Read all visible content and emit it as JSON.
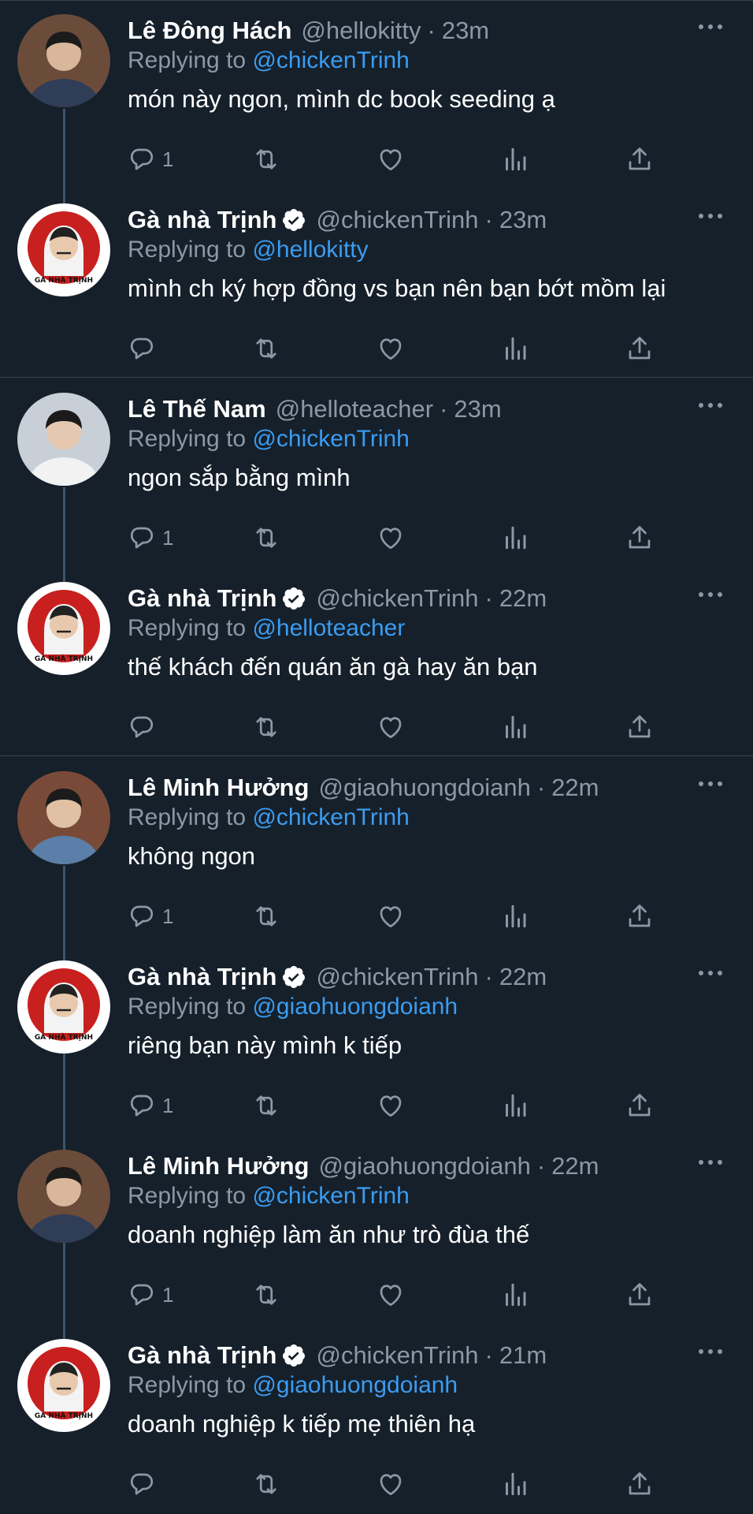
{
  "tweets": [
    {
      "name": "Lê Đông Hách",
      "handle": "@hellokitty",
      "time": "23m",
      "verified": false,
      "reply_label": "Replying to",
      "reply_to": "@chickenTrinh",
      "text": "món này ngon, mình dc book seeding ạ",
      "reply_count": "1",
      "avatar_icon": "person-photo-avatar"
    },
    {
      "name": "Gà nhà Trịnh",
      "handle": "@chickenTrinh",
      "time": "23m",
      "verified": true,
      "reply_label": "Replying to",
      "reply_to": "@hellokitty",
      "text": "mình ch ký hợp đồng vs bạn nên bạn bớt mồm lại",
      "reply_count": "",
      "avatar_icon": "chicken-brand-logo-avatar",
      "avatar_text": "GÀ NHÀ TRỊNH"
    },
    {
      "name": "Lê Thế Nam",
      "handle": "@helloteacher",
      "time": "23m",
      "verified": false,
      "reply_label": "Replying to",
      "reply_to": "@chickenTrinh",
      "text": "ngon sắp bằng mình",
      "reply_count": "1",
      "avatar_icon": "person-photo-avatar"
    },
    {
      "name": "Gà nhà Trịnh",
      "handle": "@chickenTrinh",
      "time": "22m",
      "verified": true,
      "reply_label": "Replying to",
      "reply_to": "@helloteacher",
      "text": "thế khách đến quán ăn gà hay ăn bạn",
      "reply_count": "",
      "avatar_icon": "chicken-brand-logo-avatar",
      "avatar_text": "GÀ NHÀ TRỊNH"
    },
    {
      "name": "Lê Minh Hưởng",
      "handle": "@giaohuongdoianh",
      "time": "22m",
      "verified": false,
      "reply_label": "Replying to",
      "reply_to": "@chickenTrinh",
      "text": "không ngon",
      "reply_count": "1",
      "avatar_icon": "person-photo-avatar"
    },
    {
      "name": "Gà nhà Trịnh",
      "handle": "@chickenTrinh",
      "time": "22m",
      "verified": true,
      "reply_label": "Replying to",
      "reply_to": "@giaohuongdoianh",
      "text": "riêng bạn này mình k tiếp",
      "reply_count": "1",
      "avatar_icon": "chicken-brand-logo-avatar",
      "avatar_text": "GÀ NHÀ TRỊNH"
    },
    {
      "name": "Lê Minh Hưởng",
      "handle": "@giaohuongdoianh",
      "time": "22m",
      "verified": false,
      "reply_label": "Replying to",
      "reply_to": "@chickenTrinh",
      "text": "doanh nghiệp làm ăn như trò đùa thế",
      "reply_count": "1",
      "avatar_icon": "person-photo-avatar"
    },
    {
      "name": "Gà nhà Trịnh",
      "handle": "@chickenTrinh",
      "time": "21m",
      "verified": true,
      "reply_label": "Replying to",
      "reply_to": "@giaohuongdoianh",
      "text": "doanh nghiệp k tiếp mẹ thiên hạ",
      "reply_count": "",
      "avatar_icon": "chicken-brand-logo-avatar",
      "avatar_text": "GÀ NHÀ TRỊNH"
    }
  ],
  "theme": {
    "background": "#15202b",
    "divider": "#38444d",
    "muted": "#8b98a5",
    "link": "#3b9cf0",
    "verified": "#ffffff",
    "brand_red": "#c8201f"
  }
}
